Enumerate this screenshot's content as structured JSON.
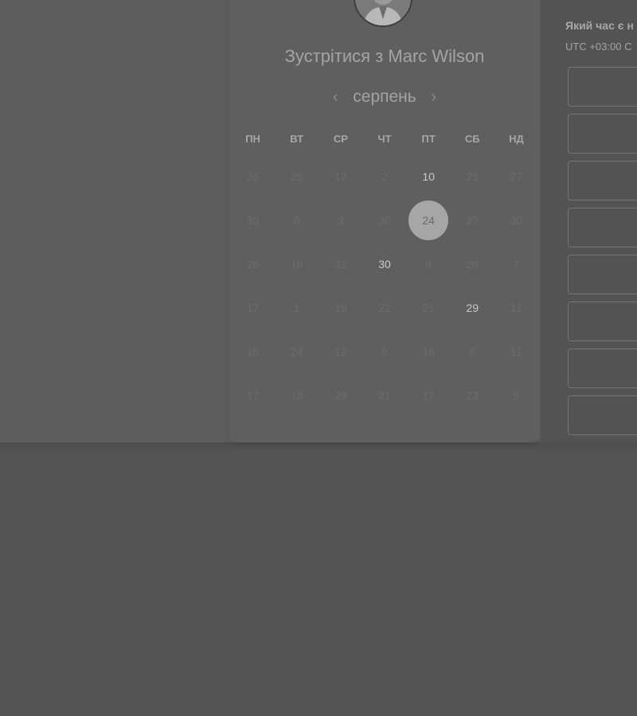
{
  "header": {
    "meet_title": "Зустрітися з Marc Wilson"
  },
  "calendar": {
    "month": "серпень",
    "weekdays": [
      "ПН",
      "ВТ",
      "СР",
      "ЧТ",
      "ПТ",
      "СБ",
      "НД"
    ],
    "weeks": [
      [
        "26",
        "25",
        "17",
        "2",
        "10",
        "21",
        "27"
      ],
      [
        "30",
        "6",
        "3",
        "30",
        "24",
        "27",
        "30"
      ],
      [
        "26",
        "16",
        "31",
        "30",
        "8",
        "20",
        "7"
      ],
      [
        "17",
        "1",
        "19",
        "22",
        "21",
        "29",
        "11"
      ],
      [
        "16",
        "24",
        "12",
        "9",
        "16",
        "8",
        "11"
      ],
      [
        "17",
        "16",
        "28",
        "21",
        "17",
        "23",
        "5"
      ]
    ],
    "available": [
      [
        0,
        4
      ],
      [
        2,
        3
      ],
      [
        3,
        5
      ]
    ],
    "selected": [
      1,
      4
    ]
  },
  "time_panel": {
    "question": "Який час є н",
    "timezone": "UTC +03:00 C"
  },
  "colors": {
    "overlay_background": "#545454",
    "selected_day": "#a6a6a6"
  }
}
